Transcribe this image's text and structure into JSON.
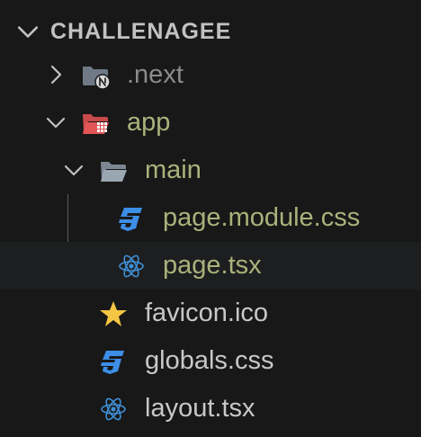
{
  "explorer": {
    "section_title": "CHALLENAGEE",
    "items": [
      {
        "label": "next_folder",
        "text": ".next",
        "color": "#8b8b8b"
      },
      {
        "label": "app_folder",
        "text": "app",
        "color": "#a9b27b"
      },
      {
        "label": "main_folder",
        "text": "main",
        "color": "#a9b27b"
      },
      {
        "label": "page_module_css",
        "text": "page.module.css",
        "color": "#a9b27b"
      },
      {
        "label": "page_tsx",
        "text": "page.tsx",
        "color": "#a9b27b"
      },
      {
        "label": "favicon",
        "text": "favicon.ico",
        "color": "#c8c8c8"
      },
      {
        "label": "globals_css",
        "text": "globals.css",
        "color": "#c8c8c8"
      },
      {
        "label": "layout_tsx",
        "text": "layout.tsx",
        "color": "#c8c8c8"
      }
    ]
  },
  "colors": {
    "background": "#181818",
    "modified_text": "#a9b27b",
    "dimmed_text": "#8b8b8b",
    "normal_text": "#c8c8c8",
    "react_blue": "#3f8fd6",
    "css_blue": "#3d8ee6",
    "folder_gray": "#8e9aa6",
    "app_folder_red": "#e05555",
    "star_yellow": "#f6c544"
  }
}
